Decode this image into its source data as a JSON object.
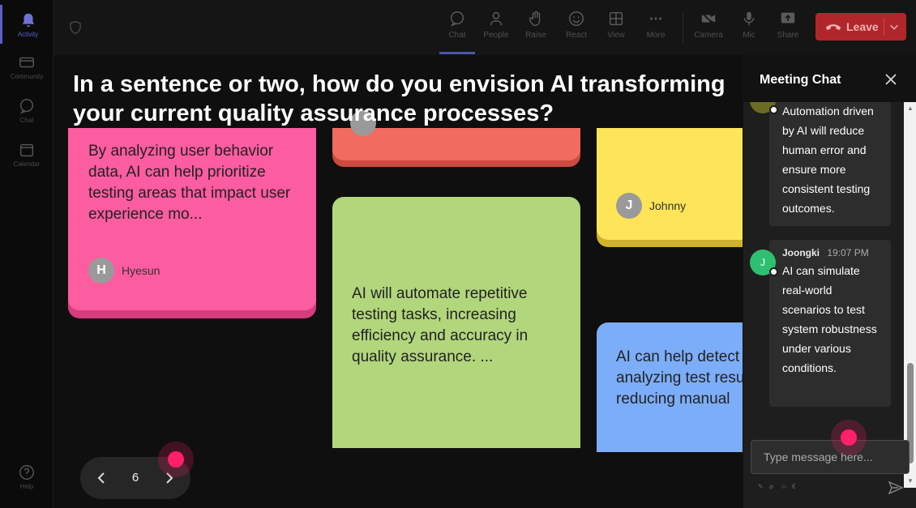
{
  "rail": {
    "items": [
      {
        "label": "Activity",
        "icon": "bell-icon",
        "active": true
      },
      {
        "label": "Community",
        "icon": "community-icon"
      },
      {
        "label": "Chat",
        "icon": "chat-icon"
      },
      {
        "label": "Calendar",
        "icon": "calendar-icon"
      },
      {
        "label": "Help",
        "icon": "help-icon"
      }
    ]
  },
  "toolbar": {
    "chat": "Chat",
    "people": "People",
    "raise": "Raise",
    "react": "React",
    "view": "View",
    "more": "More",
    "camera": "Camera",
    "mic": "Mic",
    "share": "Share",
    "leave": "Leave",
    "leave_color": "#b0262b"
  },
  "question": "In a sentence or two, how do you envision AI transforming your current quality assurance processes?",
  "cards": [
    {
      "id": "pink",
      "text": "By analyzing user behavior data, AI can help prioritize testing areas that impact user experience mo...",
      "author": "Hyesun",
      "initial": "H",
      "color": "#fc5ca0"
    },
    {
      "id": "red",
      "text": "",
      "color": "#f26b5f"
    },
    {
      "id": "yellow",
      "text": "",
      "author": "Johnny",
      "initial": "J",
      "color": "#fde458"
    },
    {
      "id": "green",
      "text": "AI will automate repetitive testing tasks, increasing efficiency and accuracy in quality assurance. ...",
      "color": "#b1d67c"
    },
    {
      "id": "blue",
      "text": "AI can help detect faster by analyzing test results in real reducing manual",
      "color": "#7cadf8"
    }
  ],
  "pager": {
    "page": "6"
  },
  "chat": {
    "title": "Meeting Chat",
    "messages": [
      {
        "text": "Automation driven by AI will reduce human error and ensure more consistent testing outcomes."
      },
      {
        "name": "Joongki",
        "time": "19:07 PM",
        "initial": "J",
        "avatar_color": "#2fbf71",
        "text": "AI can simulate real-world scenarios to test system robustness under various conditions."
      }
    ],
    "input_placeholder": "Type message here...",
    "accent": "#ff1f6b"
  }
}
